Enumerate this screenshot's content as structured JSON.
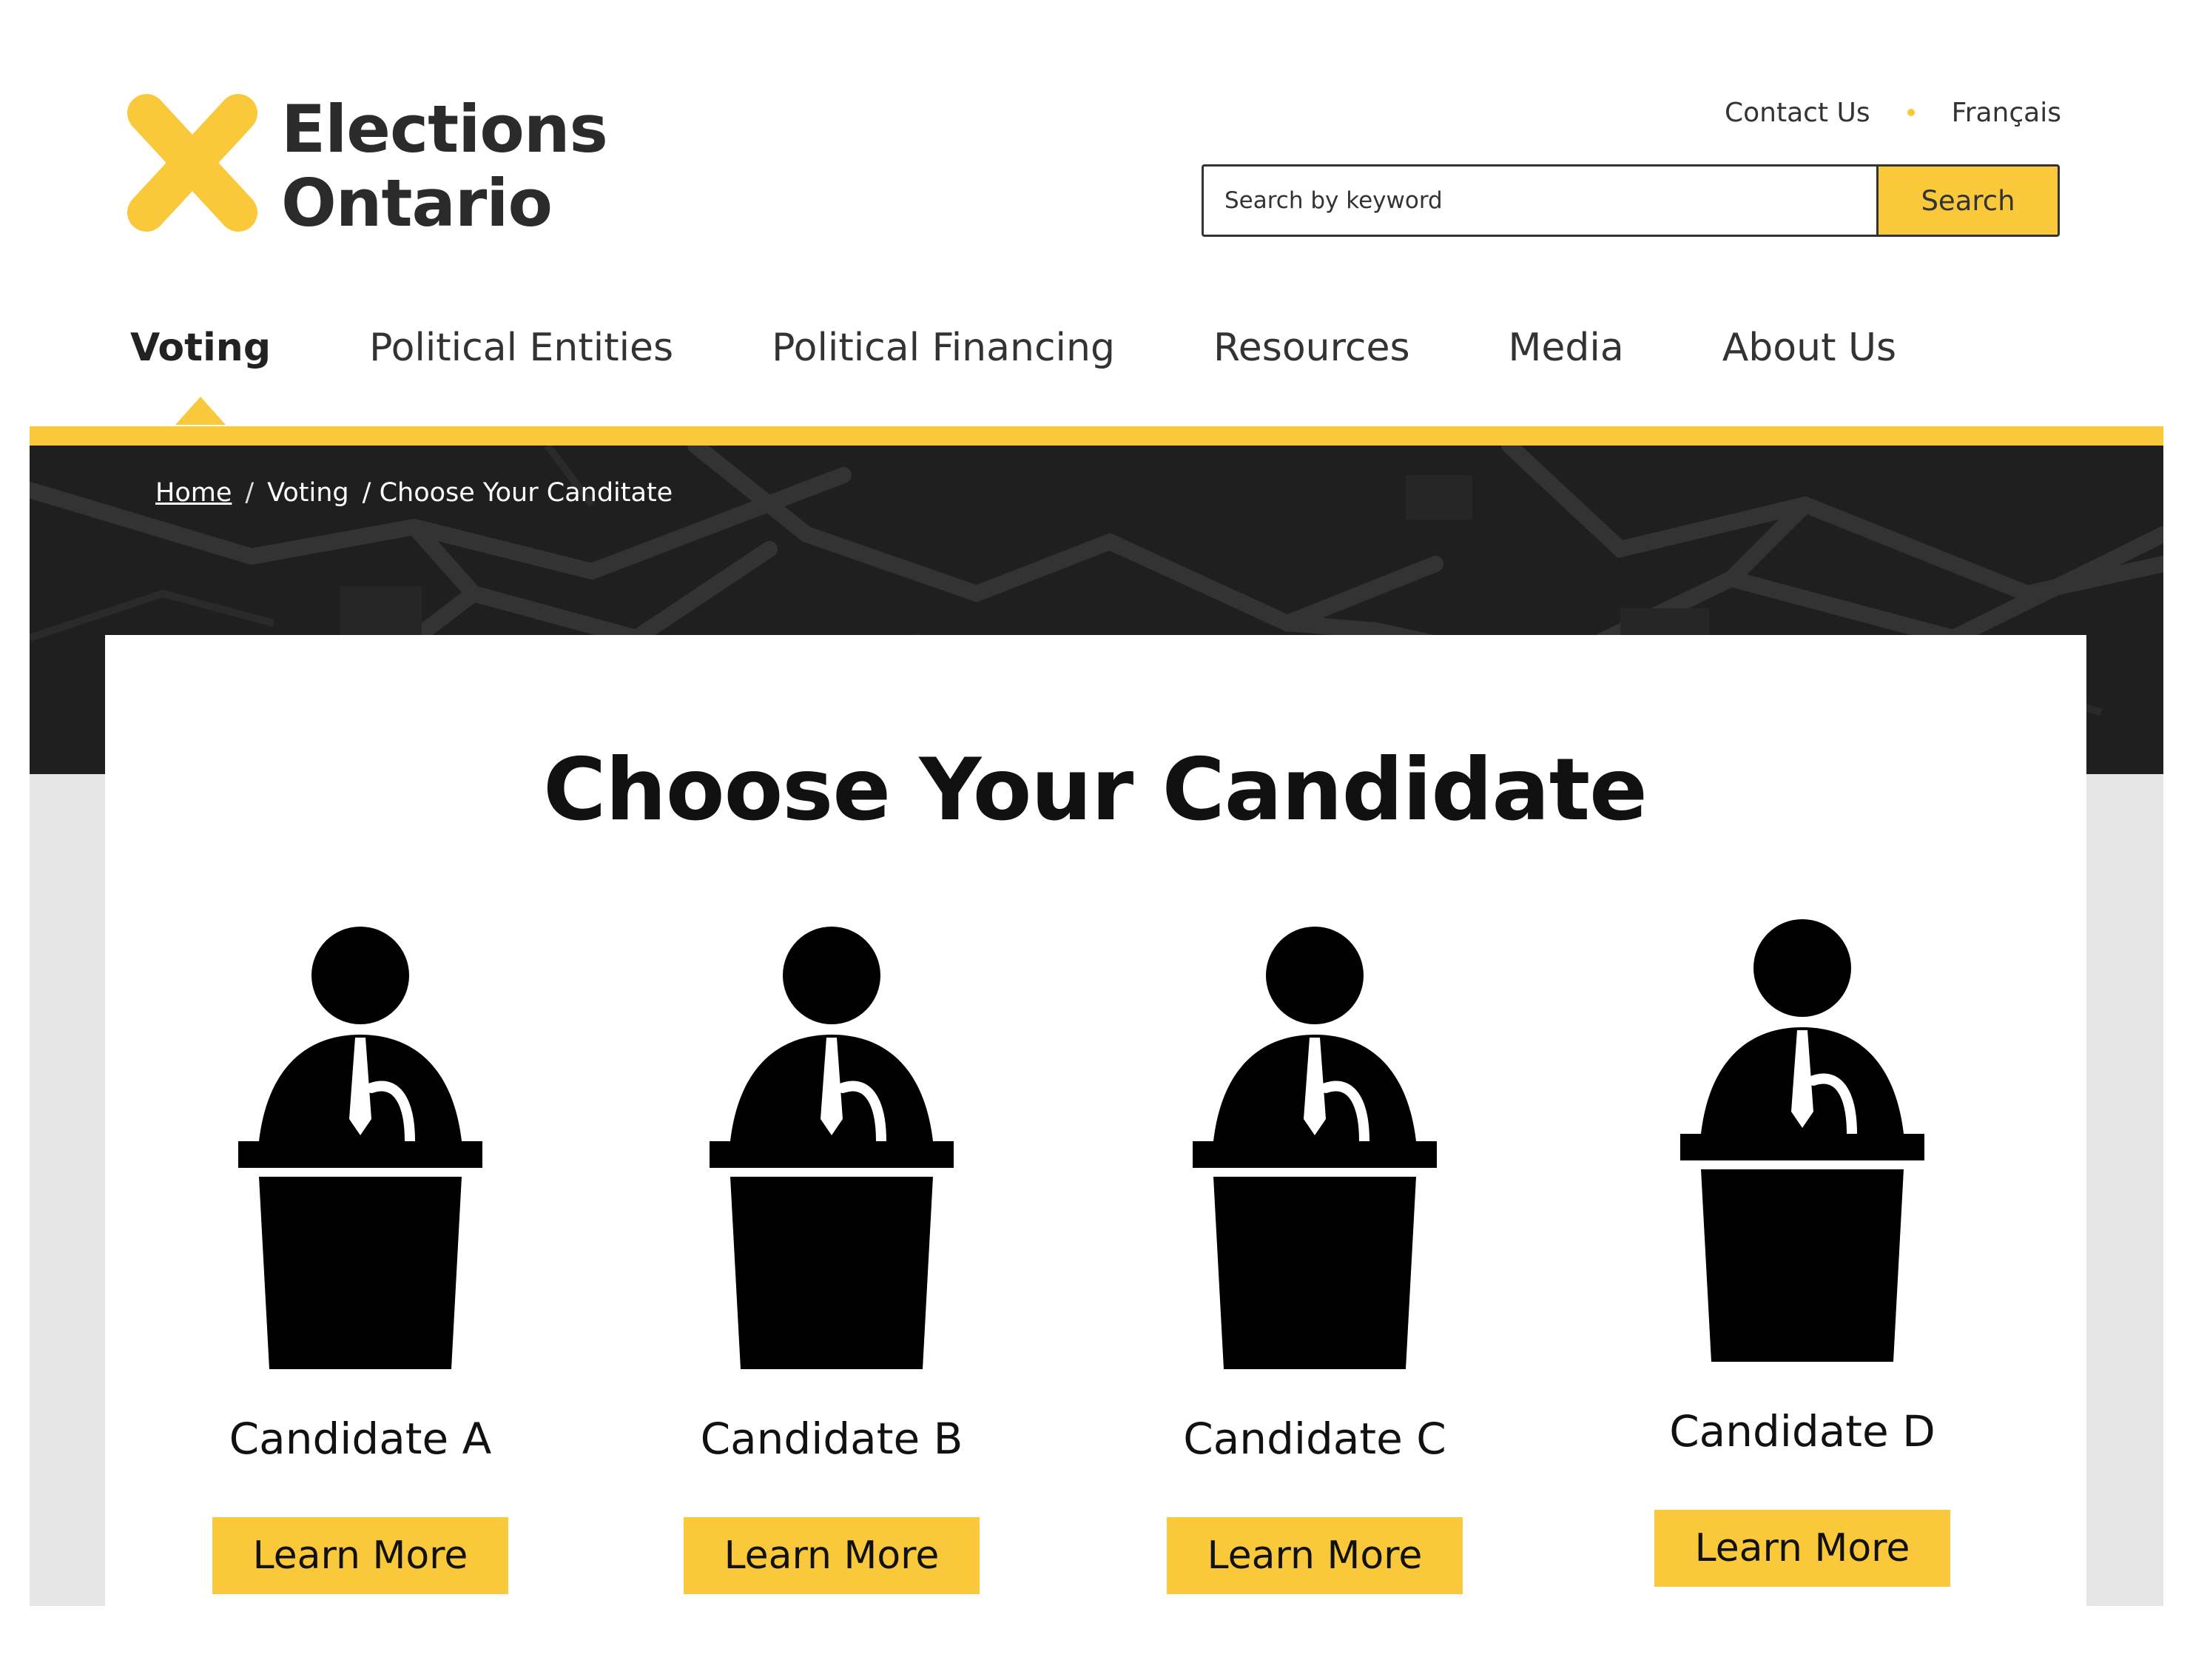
{
  "brand": {
    "name_line1": "Elections",
    "name_line2": "Ontario",
    "accent_color": "#f9c93b",
    "icon": "x-logo-icon"
  },
  "utility_nav": {
    "contact": "Contact Us",
    "language": "Français"
  },
  "search": {
    "placeholder": "Search by keyword",
    "button_label": "Search"
  },
  "main_nav": {
    "items": [
      {
        "label": "Voting",
        "active": true
      },
      {
        "label": "Political Entities"
      },
      {
        "label": "Political Financing"
      },
      {
        "label": "Resources"
      },
      {
        "label": "Media"
      },
      {
        "label": "About Us"
      }
    ]
  },
  "breadcrumb": {
    "home": "Home",
    "sep1": "/",
    "section": "Voting",
    "current": "/ Choose Your Canditate"
  },
  "page": {
    "title": "Choose Your Candidate"
  },
  "candidates": [
    {
      "name": "Candidate A",
      "button": "Learn More",
      "icon": "candidate-podium-icon"
    },
    {
      "name": "Candidate B",
      "button": "Learn More",
      "icon": "candidate-podium-icon"
    },
    {
      "name": "Candidate C",
      "button": "Learn More",
      "icon": "candidate-podium-icon"
    },
    {
      "name": "Candidate D",
      "button": "Learn More",
      "icon": "candidate-podium-icon"
    }
  ]
}
